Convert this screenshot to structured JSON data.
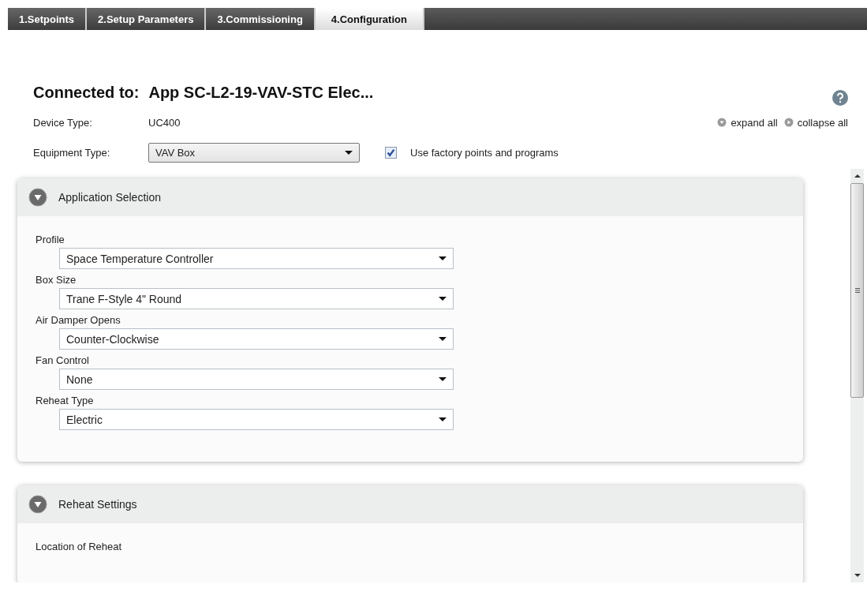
{
  "tabs": [
    {
      "label": "1.Setpoints",
      "selected": false
    },
    {
      "label": "2.Setup Parameters",
      "selected": false
    },
    {
      "label": "3.Commissioning",
      "selected": false
    },
    {
      "label": "4.Configuration",
      "selected": true
    }
  ],
  "header": {
    "connected_label": "Connected to:",
    "device_name": "App SC-L2-19-VAV-STC Elec..."
  },
  "device_type": {
    "label": "Device Type:",
    "value": "UC400"
  },
  "equipment_type": {
    "label": "Equipment Type:",
    "value": "VAV Box"
  },
  "factory_checkbox": {
    "label": "Use factory points and programs",
    "checked": true
  },
  "expand_all": "expand all",
  "collapse_all": "collapse all",
  "sections": [
    {
      "title": "Application Selection",
      "expanded": true,
      "fields": [
        {
          "label": "Profile",
          "value": "Space Temperature Controller"
        },
        {
          "label": "Box Size",
          "value": "Trane F-Style 4\" Round"
        },
        {
          "label": "Air Damper Opens",
          "value": "Counter-Clockwise"
        },
        {
          "label": "Fan Control",
          "value": "None"
        },
        {
          "label": "Reheat Type",
          "value": "Electric"
        }
      ]
    },
    {
      "title": "Reheat Settings",
      "expanded": true,
      "fields": [
        {
          "label": "Location of Reheat"
        }
      ]
    }
  ]
}
